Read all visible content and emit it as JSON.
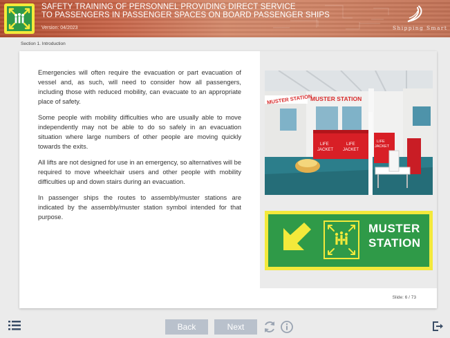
{
  "header": {
    "title_line1": "SAFETY TRAINING OF PERSONNEL PROVIDING DIRECT SERVICE",
    "title_line2": "TO PASSENGERS IN PASSENGER SPACES ON BOARD PASSENGER SHIPS",
    "version": "Version: 04/2023",
    "brand": "Shipping Smart",
    "logo_icon": "muster-station-icon"
  },
  "breadcrumb": "Section 1. Introduction",
  "content": {
    "paragraphs": [
      "Emergencies will often require the evacuation or part evacuation of vessel and, as such, will need to consider how all passengers, including those with reduced mobility, can evacuate to an appropriate place of safety.",
      "Some people with mobility difficulties who are usually able to move independently may not be able to do so safely in an evacuation situation where large numbers of other people are moving quickly towards the exits.",
      "All lifts are not designed for use in an emergency, so alternatives will be required to move wheelchair users and other people with mobility difficulties up and down stairs during an evacuation.",
      "In passenger ships the routes to assembly/muster stations are indicated by the assembly/muster station symbol intended for that purpose."
    ]
  },
  "photo": {
    "sign_left": "MUSTER STATION",
    "sign_right": "MUSTER STATION",
    "box1_line1": "LIFE",
    "box1_line2": "JACKET",
    "box2_line1": "LIFE",
    "box2_line2": "JACKET",
    "box3_line1": "LIFE",
    "box3_line2": "JACKET"
  },
  "sign": {
    "line1": "MUSTER",
    "line2": "STATION",
    "arrow_icon": "arrow-down-left-icon",
    "symbol_icon": "muster-station-icon",
    "colors": {
      "border": "#f3e93b",
      "background": "#2f9a48"
    }
  },
  "slide_counter": "Slide: 6 / 73",
  "nav": {
    "back_label": "Back",
    "next_label": "Next",
    "menu_icon": "menu-list-icon",
    "replay_icon": "replay-icon",
    "info_icon": "info-icon",
    "exit_icon": "exit-icon"
  },
  "colors": {
    "header": "#c8664a",
    "nav_button": "#b9c1cc",
    "icon": "#9aa4b2",
    "exit_icon": "#3a4d66"
  }
}
